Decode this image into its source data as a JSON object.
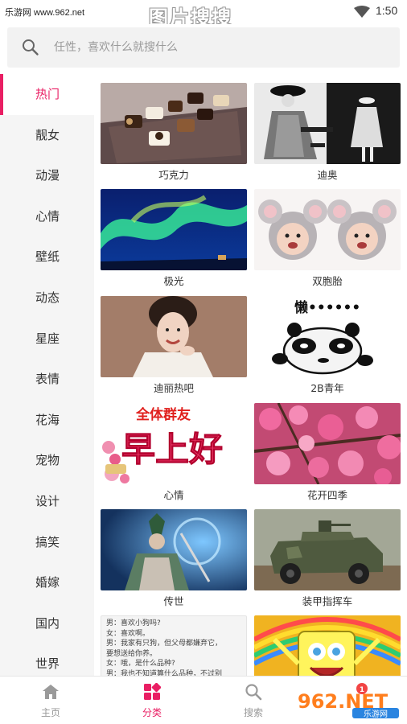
{
  "status_bar": {
    "watermark": "乐游网 www.962.net",
    "title": "图片搜搜",
    "time": "1:50",
    "wifi_icon": "wifi-icon"
  },
  "search": {
    "placeholder": "任性，喜欢什么就搜什么",
    "icon": "search-icon"
  },
  "sidebar": {
    "active_color": "#e91e63",
    "items": [
      {
        "label": "热门"
      },
      {
        "label": "靓女"
      },
      {
        "label": "动漫"
      },
      {
        "label": "心情"
      },
      {
        "label": "壁纸"
      },
      {
        "label": "动态"
      },
      {
        "label": "星座"
      },
      {
        "label": "表情"
      },
      {
        "label": "花海"
      },
      {
        "label": "宠物"
      },
      {
        "label": "设计"
      },
      {
        "label": "搞笑"
      },
      {
        "label": "婚嫁"
      },
      {
        "label": "国内"
      },
      {
        "label": "世界"
      }
    ]
  },
  "grid": {
    "cards": [
      {
        "label": "巧克力",
        "thumb": "chocolate-photo"
      },
      {
        "label": "迪奥",
        "thumb": "dior-photo"
      },
      {
        "label": "极光",
        "thumb": "aurora-photo"
      },
      {
        "label": "双胞胎",
        "thumb": "twins-photo"
      },
      {
        "label": "迪丽热吧",
        "thumb": "actress-photo"
      },
      {
        "label": "2B青年",
        "thumb": "panda-meme"
      },
      {
        "label": "心情",
        "thumb": "greeting-card"
      },
      {
        "label": "花开四季",
        "thumb": "blossom-photo"
      },
      {
        "label": "传世",
        "thumb": "warrior-art"
      },
      {
        "label": "装甲指挥车",
        "thumb": "armored-vehicle-photo"
      },
      {
        "label": "",
        "thumb": "dialogue-text-image"
      },
      {
        "label": "",
        "thumb": "spongebob-image"
      }
    ],
    "image_text": {
      "lazy_title": "懒••••••",
      "greeting_top": "全体群友",
      "greeting_main": "早上好",
      "dialogue": [
        "男：喜欢小狗吗?",
        "女：喜欢啊。",
        "男：我家有只狗，但父母都嫌弃它，",
        "要想送给你养。",
        "女：哦，是什么品种?",
        "男：我也不知道算什么品种，不过别"
      ]
    }
  },
  "bottom_nav": {
    "items": [
      {
        "label": "主页",
        "icon": "home-icon"
      },
      {
        "label": "分类",
        "icon": "category-icon"
      },
      {
        "label": "搜索",
        "icon": "search-icon"
      },
      {
        "label": "",
        "icon": ""
      }
    ]
  },
  "watermark": {
    "badge": "1",
    "brand": "962.NET",
    "subtitle": "乐游网"
  },
  "colors": {
    "accent": "#e91e63",
    "sidebar_bg": "#f5f5f5"
  }
}
